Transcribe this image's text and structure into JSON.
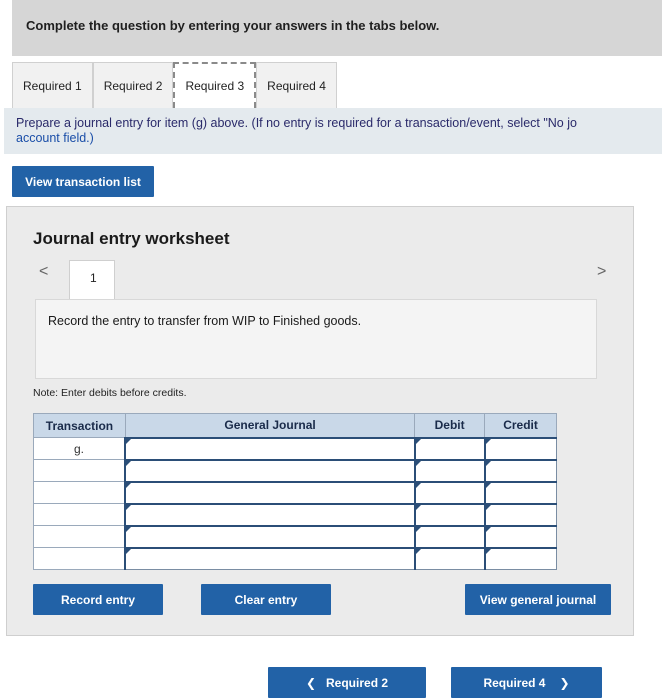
{
  "header": {
    "question": "Complete the question by entering your answers in the tabs below."
  },
  "tabs": [
    {
      "label": "Required 1"
    },
    {
      "label": "Required 2"
    },
    {
      "label": "Required 3",
      "active": true
    },
    {
      "label": "Required 4"
    }
  ],
  "instruction": {
    "line1": "Prepare a journal entry for item (g) above. (If no entry is required for a transaction/event, select \"No jo",
    "line2": "account field.)"
  },
  "buttons": {
    "view_transaction_list": "View transaction list",
    "record_entry": "Record entry",
    "clear_entry": "Clear entry",
    "view_general_journal": "View general journal",
    "prev_required": "Required 2",
    "next_required": "Required 4"
  },
  "worksheet": {
    "title": "Journal entry worksheet",
    "page": "1",
    "nav_prev": "<",
    "nav_next": ">",
    "entry_text": "Record the entry to transfer from WIP to Finished goods.",
    "note": "Note: Enter debits before credits."
  },
  "journal_table": {
    "headers": [
      "Transaction",
      "General Journal",
      "Debit",
      "Credit"
    ],
    "rows": [
      {
        "transaction": "g.",
        "account": "",
        "debit": "",
        "credit": ""
      },
      {
        "transaction": "",
        "account": "",
        "debit": "",
        "credit": ""
      },
      {
        "transaction": "",
        "account": "",
        "debit": "",
        "credit": ""
      },
      {
        "transaction": "",
        "account": "",
        "debit": "",
        "credit": ""
      },
      {
        "transaction": "",
        "account": "",
        "debit": "",
        "credit": ""
      },
      {
        "transaction": "",
        "account": "",
        "debit": "",
        "credit": ""
      }
    ]
  },
  "colors": {
    "primary_button": "#2262a7",
    "table_header": "#c9d8e8",
    "header_band": "#d6d6d6"
  }
}
